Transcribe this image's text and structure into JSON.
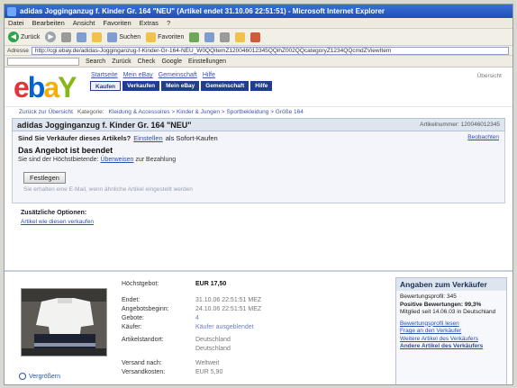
{
  "window": {
    "title": "adidas Jogginganzug f. Kinder Gr. 164 \"NEU\" (Artikel endet 31.10.06 22:51:51) - Microsoft Internet Explorer"
  },
  "menu": [
    "Datei",
    "Bearbeiten",
    "Ansicht",
    "Favoriten",
    "Extras",
    "?"
  ],
  "toolbar": {
    "back": "Zurück",
    "search": "Suchen",
    "favorites": "Favoriten"
  },
  "address": {
    "label": "Adresse",
    "url": "http://cgi.ebay.de/adidas-Jogginganzug-f-Kinder-Gr-164-NEU_W0QQitemZ120046012345QQihZ002QQcategoryZ1234QQcmdZViewItem"
  },
  "searchbar": {
    "field_value": "",
    "buttons": [
      "Search",
      "Zurück",
      "Check",
      "Google",
      "Einstellungen"
    ]
  },
  "header": {
    "top_links": [
      "Startseite",
      "Mein eBay",
      "Gemeinschaft",
      "Hilfe"
    ],
    "tabs": [
      "Kaufen",
      "Verkaufen",
      "Mein eBay",
      "Gemeinschaft",
      "Hilfe"
    ],
    "sitemap": "Übersicht"
  },
  "breadcrumb": {
    "back": "Zurück zur Übersicht",
    "label": "Kategorie:",
    "path": "Kleidung & Accessoires > Kinder & Jungen > Sportbekleidung > Größe 164"
  },
  "item": {
    "title": "adidas Jogginganzug f. Kinder Gr. 164 \"NEU\"",
    "number": "Artikelnummer: 120046012345"
  },
  "status": {
    "question": "Sind Sie Verkäufer dieses Artikels?",
    "question_link": "Einstellen",
    "question_suffix": "als Sofort-Kaufen",
    "ended": "Das Angebot ist beendet",
    "notice": "Sie sind der Höchstbietende:",
    "notice_link": "Überweisen",
    "notice_suffix": "zur Bezahlung",
    "follow_button": "Festlegen",
    "follow_note": "Sie erhalten eine E-Mail, wenn ähnliche Artikel eingestellt werden",
    "add_watch": "Beobachten"
  },
  "similar": {
    "heading": "Zusätzliche Optionen:",
    "link": "Artikel wie diesen verkaufen"
  },
  "bid": {
    "rows": [
      {
        "k": "Höchstgebot:",
        "v": "EUR 17,50"
      },
      {
        "k": "Endet:",
        "v": "31.10.06 22:51:51 MEZ"
      },
      {
        "k": "Angebotsbeginn:",
        "v": "24.10.06 22:51:51 MEZ"
      },
      {
        "k": "Gebote:",
        "v": "4"
      },
      {
        "k": "Käufer:",
        "v": "Käufer ausgeblendet"
      },
      {
        "k": "Artikelstandort:",
        "v": "Deutschland"
      },
      {
        "k": "",
        "v": "Deutschland"
      },
      {
        "k": "Versand nach:",
        "v": "Weltweit"
      },
      {
        "k": "Versandkosten:",
        "v": "EUR 5,90"
      }
    ]
  },
  "enlarge": "Vergrößern",
  "seller": {
    "heading": "Angaben zum Verkäufer",
    "lines": [
      "Bewertungsprofil: 345",
      "Positive Bewertungen: 99,3%",
      "Mitglied seit 14.06.03 in Deutschland"
    ],
    "links": [
      "Bewertungsprofil lesen",
      "Frage an den Verkäufer",
      "Weitere Artikel des Verkäufers",
      "Andere Artikel des Verkäufers"
    ]
  }
}
